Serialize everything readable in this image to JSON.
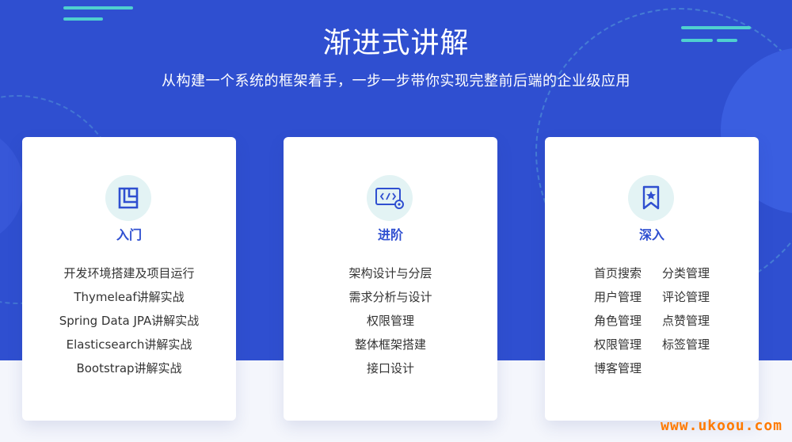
{
  "header": {
    "title": "渐进式讲解",
    "subtitle": "从构建一个系统的框架着手，一步一步带你实现完整前后端的企业级应用"
  },
  "cards": [
    {
      "title": "入门",
      "icon": "layout-icon",
      "items": [
        "开发环境搭建及项目运行",
        "Thymeleaf讲解实战",
        "Spring Data JPA讲解实战",
        "Elasticsearch讲解实战",
        "Bootstrap讲解实战"
      ]
    },
    {
      "title": "进阶",
      "icon": "code-gear-icon",
      "items": [
        "架构设计与分层",
        "需求分析与设计",
        "权限管理",
        "整体框架搭建",
        "接口设计"
      ]
    },
    {
      "title": "深入",
      "icon": "bookmark-star-icon",
      "items": [
        "首页搜索",
        "分类管理",
        "用户管理",
        "评论管理",
        "角色管理",
        "点赞管理",
        "权限管理",
        "标签管理",
        "博客管理"
      ]
    }
  ],
  "watermark": "www.ukoou.com",
  "colors": {
    "primary": "#2f4fd0",
    "accent": "#4fd0cf",
    "watermark": "#ff7a00"
  }
}
